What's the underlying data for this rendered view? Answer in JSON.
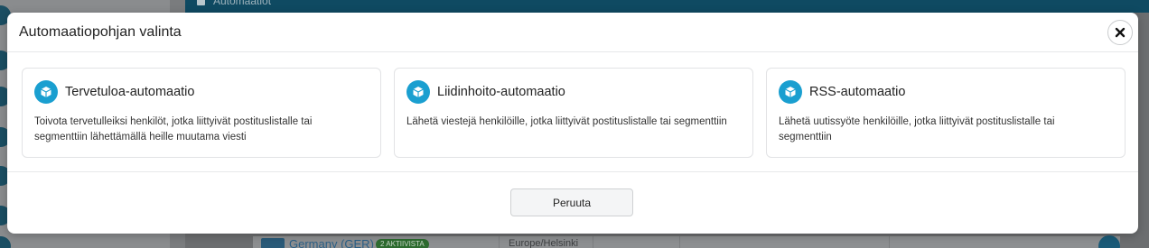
{
  "background": {
    "header_title": "Automaatiot",
    "row": {
      "name": "Germany (GER)",
      "badge": "2 AKTIIVISTA",
      "timezone": "Europe/Helsinki"
    }
  },
  "modal": {
    "title": "Automaatiopohjan valinta",
    "close_icon": "close-icon",
    "templates": [
      {
        "icon": "cube-icon",
        "title": "Tervetuloa-automaatio",
        "description": "Toivota tervetulleiksi henkilöt, jotka liittyivät postituslistalle tai segmenttiin lähettämällä heille muutama viesti"
      },
      {
        "icon": "cube-icon",
        "title": "Liidinhoito-automaatio",
        "description": "Lähetä viestejä henkilöille, jotka liittyivät postituslistalle tai segmenttiin"
      },
      {
        "icon": "cube-icon",
        "title": "RSS-automaatio",
        "description": "Lähetä uutissyöte henkilöille, jotka liittyivät postituslistalle tai segmenttiin"
      }
    ],
    "cancel_label": "Peruuta"
  },
  "colors": {
    "accent": "#1a9fd0",
    "overlay": "#6f7173",
    "header_bg": "#0f4a62"
  }
}
